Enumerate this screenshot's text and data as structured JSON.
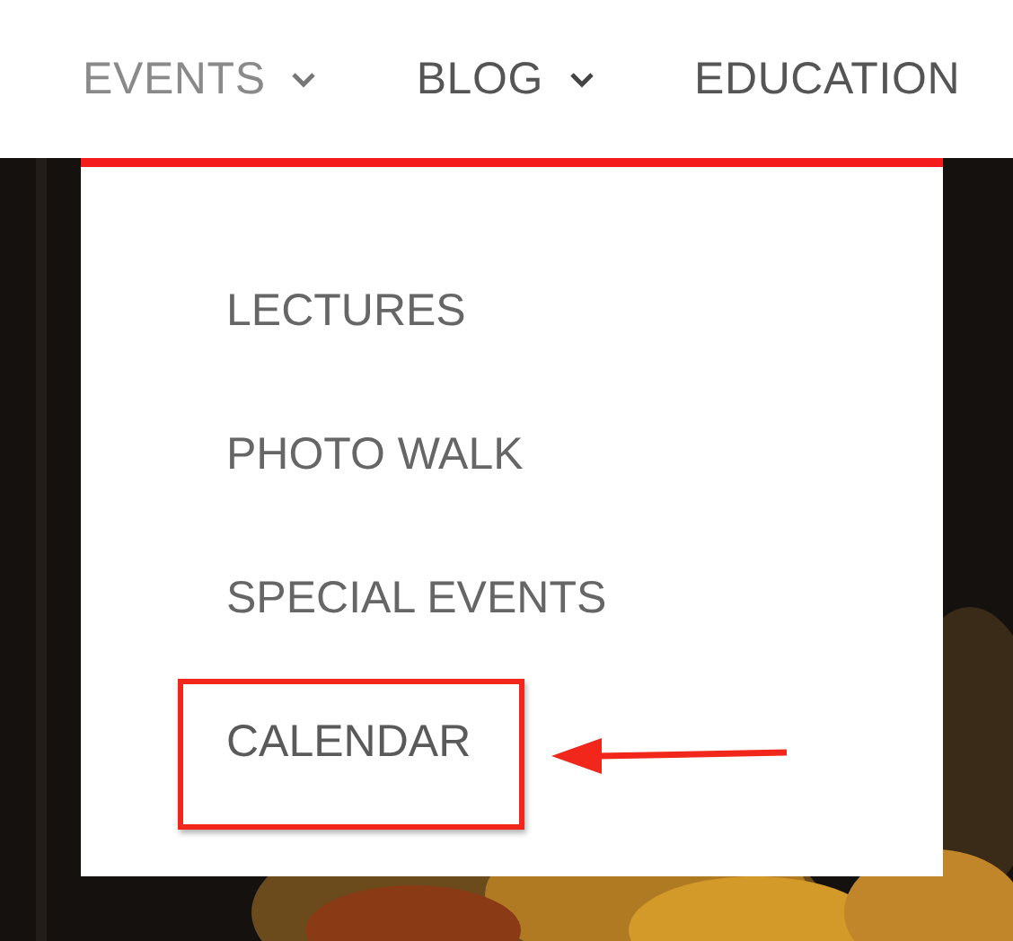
{
  "nav": [
    {
      "label": "EVENTS",
      "selected": true,
      "dropdown": true
    },
    {
      "label": "BLOG",
      "selected": false,
      "dropdown": true
    },
    {
      "label": "EDUCATION",
      "selected": false,
      "dropdown": false
    }
  ],
  "dropdown_menu": [
    {
      "label": "LECTURES",
      "highlighted": false
    },
    {
      "label": "PHOTO WALK",
      "highlighted": false
    },
    {
      "label": "SPECIAL EVENTS",
      "highlighted": false
    },
    {
      "label": "CALENDAR",
      "highlighted": true
    }
  ]
}
